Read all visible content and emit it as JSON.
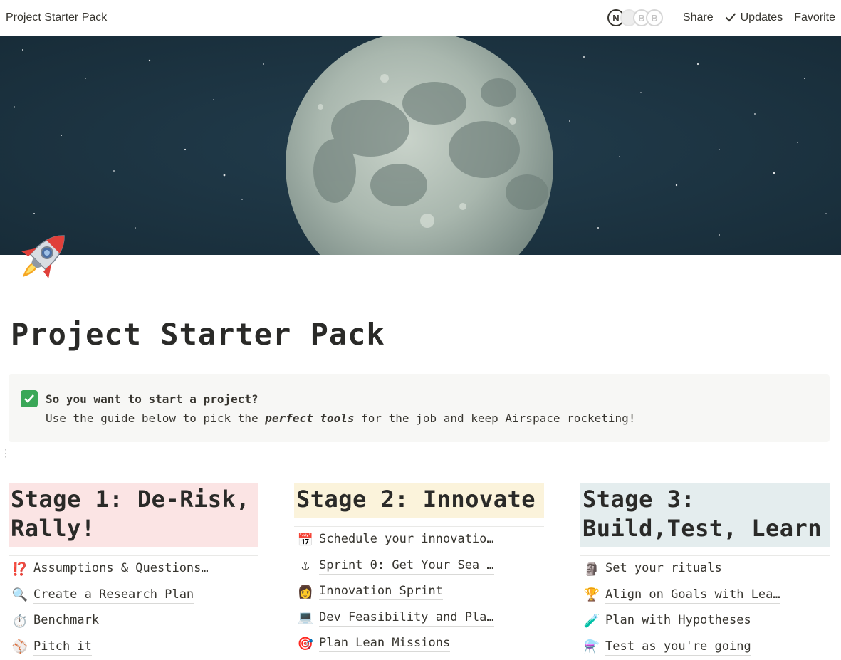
{
  "topbar": {
    "breadcrumb": "Project Starter Pack",
    "avatars": [
      "N",
      "B",
      "B"
    ],
    "share_label": "Share",
    "updates_label": "Updates",
    "favorite_label": "Favorite"
  },
  "page": {
    "icon": "rocket-icon",
    "title": "Project Starter Pack"
  },
  "callout": {
    "icon": "check-mark-icon",
    "heading": "So you want to start a project?",
    "text_before": "Use the guide below to pick the ",
    "text_emphasis": "perfect tools",
    "text_after": " for the job and keep Airspace rocketing!"
  },
  "stages": [
    {
      "title": "Stage 1: De-Risk, Rally!",
      "color": "#fbe4e4",
      "items": [
        {
          "icon": "⁉️",
          "label": "Assumptions & Questions…"
        },
        {
          "icon": "🔍",
          "label": "Create a Research Plan"
        },
        {
          "icon": "⏱️",
          "label": "Benchmark"
        },
        {
          "icon": "⚾",
          "label": "Pitch it"
        }
      ]
    },
    {
      "title": "Stage 2: Innovate",
      "color": "#fbf3db",
      "items": [
        {
          "icon": "📅",
          "label": "Schedule your innovatio…"
        },
        {
          "icon": "⚓",
          "label": "Sprint 0: Get Your Sea …"
        },
        {
          "icon": "👩",
          "label": "Innovation Sprint"
        },
        {
          "icon": "💻",
          "label": "Dev Feasibility and Pla…"
        },
        {
          "icon": "🎯",
          "label": "Plan Lean Missions"
        }
      ]
    },
    {
      "title": "Stage 3: Build,Test, Learn",
      "color": "#e4edee",
      "items": [
        {
          "icon": "🗿",
          "label": "Set your rituals"
        },
        {
          "icon": "🏆",
          "label": "Align on Goals with Lea…"
        },
        {
          "icon": "🧪",
          "label": "Plan with Hypotheses"
        },
        {
          "icon": "⚗️",
          "label": "Test as you're going"
        }
      ]
    }
  ]
}
